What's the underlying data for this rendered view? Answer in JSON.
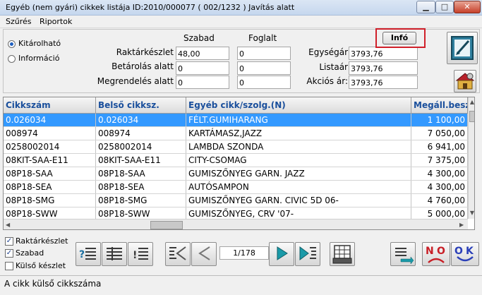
{
  "window": {
    "title": "Egyéb (nem gyári) cikkek listája  ID:2010/000077 ( 002/1232 )  Javítás alatt"
  },
  "menu": {
    "items": [
      "Szűrés",
      "Riportok"
    ]
  },
  "radios": {
    "kitarolhato": "Kitárolható",
    "informacio": "Információ"
  },
  "form": {
    "col_szabad": "Szabad",
    "col_foglalt": "Foglalt",
    "raktarkeszlet_label": "Raktárkészlet",
    "raktarkeszlet_szabad": "48,00",
    "raktarkeszlet_foglalt": "0",
    "betarolas_label": "Betárolás alatt",
    "betarolas_szabad": "0",
    "betarolas_foglalt": "0",
    "megrendeles_label": "Megrendelés alatt",
    "megrendeles_szabad": "0",
    "megrendeles_foglalt": "0",
    "egysegar_label": "Egységár",
    "egysegar_value": "3793,76",
    "listaar_label": "Listaár",
    "listaar_value": "3793,76",
    "akcios_label": "Akciós ár:",
    "akcios_value": "3793,76"
  },
  "info_button": "Infó",
  "grid": {
    "headers": [
      "Cikkszám",
      "Belső cikksz.",
      "Egyéb cikk/szolg.(N)",
      "Megáll.besz"
    ],
    "rows": [
      [
        "0.026034",
        "0.026034",
        "FÉLT.GUMIHARANG",
        "1 100,00"
      ],
      [
        "008974",
        "008974",
        "KARTÁMASZ,JAZZ",
        "7 050,00"
      ],
      [
        "0258002014",
        "0258002014",
        "LAMBDA SZONDA",
        "6 941,00"
      ],
      [
        "08KIT-SAA-E11",
        "08KIT-SAA-E11",
        "CITY-CSOMAG",
        "7 375,00"
      ],
      [
        "08P18-SAA",
        "08P18-SAA",
        "GUMISZŐNYEG GARN. JAZZ",
        "4 300,00"
      ],
      [
        "08P18-SEA",
        "08P18-SEA",
        "AUTÓSAMPON",
        "4 300,00"
      ],
      [
        "08P18-SMG",
        "08P18-SMG",
        "GUMISZŐNYEG GARN. CIVIC 5D 06-",
        "4 760,00"
      ],
      [
        "08P18-SWW",
        "08P18-SWW",
        "GUMISZŐNYEG, CRV '07-",
        "5 000,00"
      ]
    ]
  },
  "checks": {
    "raktarkeszlet": "Raktárkészlet",
    "szabad": "Szabad",
    "kulso": "Külső készlet"
  },
  "pager": "1/178",
  "buttons": {
    "no": "NO",
    "ok": "OK"
  },
  "status": "A cikk külső cikkszáma"
}
